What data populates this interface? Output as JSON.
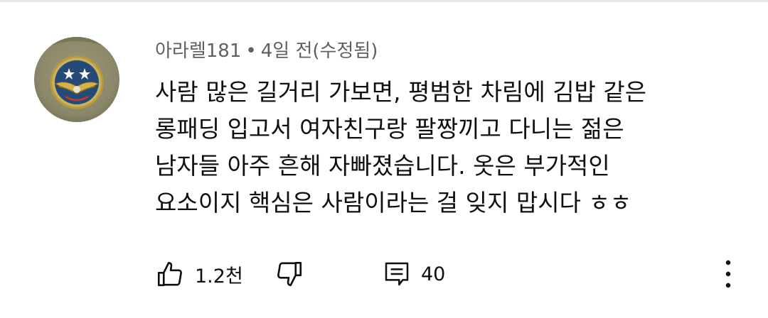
{
  "comment": {
    "author": "아라렐181",
    "separator": "•",
    "timestamp": "4일 전(수정됨)",
    "lines": [
      "사람 많은 길거리 가보면, 평범한 차림에 김밥 같은",
      "롱패딩 입고서 여자친구랑 팔짱끼고 다니는 젊은",
      "남자들 아주 흔해 자빠졌습니다. 옷은 부가적인",
      "요소이지 핵심은 사람이라는 걸 잊지 맙시다 ㅎㅎ"
    ]
  },
  "actions": {
    "like_count": "1.2천",
    "reply_count": "40"
  },
  "icons": {
    "like": "thumbs-up-icon",
    "dislike": "thumbs-down-icon",
    "reply": "comment-icon",
    "more": "more-vertical-icon"
  },
  "colors": {
    "meta_text": "#606060",
    "body_text": "#0f0f0f",
    "divider": "#e7e7e7"
  }
}
